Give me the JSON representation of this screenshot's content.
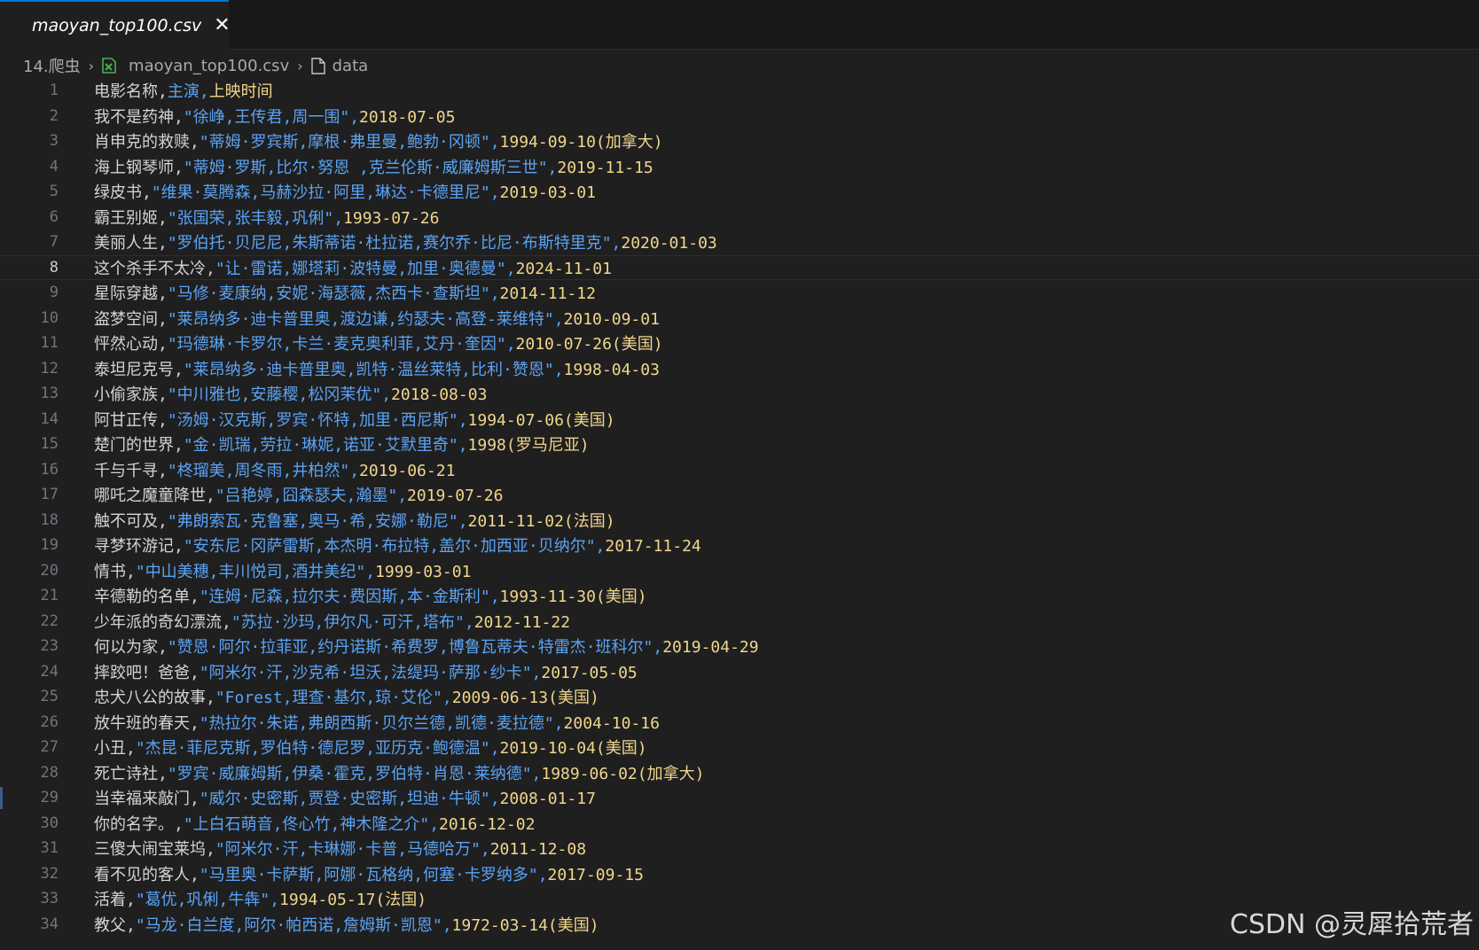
{
  "tab": {
    "title": "maoyan_top100.csv",
    "close_glyph": "✕"
  },
  "breadcrumb": {
    "folder": "14.爬虫",
    "file": "maoyan_top100.csv",
    "symbol": "data",
    "separator": "›"
  },
  "colors": {
    "field1": "#d4d4d4",
    "field2": "#5ba3f5",
    "field3": "#f1d68c",
    "accent": "#0078d4",
    "csv_icon": "#4caf50"
  },
  "active_line": 8,
  "lines": [
    {
      "n": "1",
      "a": "电影名称,",
      "b": "主演,",
      "c": "上映时间"
    },
    {
      "n": "2",
      "a": "我不是药神,",
      "b": "\"徐峥,王传君,周一围\",",
      "c": "2018-07-05"
    },
    {
      "n": "3",
      "a": "肖申克的救赎,",
      "b": "\"蒂姆·罗宾斯,摩根·弗里曼,鲍勃·冈顿\",",
      "c": "1994-09-10(加拿大)"
    },
    {
      "n": "4",
      "a": "海上钢琴师,",
      "b": "\"蒂姆·罗斯,比尔·努恩 ,克兰伦斯·威廉姆斯三世\",",
      "c": "2019-11-15"
    },
    {
      "n": "5",
      "a": "绿皮书,",
      "b": "\"维果·莫腾森,马赫沙拉·阿里,琳达·卡德里尼\",",
      "c": "2019-03-01"
    },
    {
      "n": "6",
      "a": "霸王别姬,",
      "b": "\"张国荣,张丰毅,巩俐\",",
      "c": "1993-07-26"
    },
    {
      "n": "7",
      "a": "美丽人生,",
      "b": "\"罗伯托·贝尼尼,朱斯蒂诺·杜拉诺,赛尔乔·比尼·布斯特里克\",",
      "c": "2020-01-03"
    },
    {
      "n": "8",
      "a": "这个杀手不太冷,",
      "b": "\"让·雷诺,娜塔莉·波特曼,加里·奥德曼\",",
      "c": "2024-11-01"
    },
    {
      "n": "9",
      "a": "星际穿越,",
      "b": "\"马修·麦康纳,安妮·海瑟薇,杰西卡·查斯坦\",",
      "c": "2014-11-12"
    },
    {
      "n": "10",
      "a": "盗梦空间,",
      "b": "\"莱昂纳多·迪卡普里奥,渡边谦,约瑟夫·高登-莱维特\",",
      "c": "2010-09-01"
    },
    {
      "n": "11",
      "a": "怦然心动,",
      "b": "\"玛德琳·卡罗尔,卡兰·麦克奥利菲,艾丹·奎因\",",
      "c": "2010-07-26(美国)"
    },
    {
      "n": "12",
      "a": "泰坦尼克号,",
      "b": "\"莱昂纳多·迪卡普里奥,凯特·温丝莱特,比利·赞恩\",",
      "c": "1998-04-03"
    },
    {
      "n": "13",
      "a": "小偷家族,",
      "b": "\"中川雅也,安藤樱,松冈茉优\",",
      "c": "2018-08-03"
    },
    {
      "n": "14",
      "a": "阿甘正传,",
      "b": "\"汤姆·汉克斯,罗宾·怀特,加里·西尼斯\",",
      "c": "1994-07-06(美国)"
    },
    {
      "n": "15",
      "a": "楚门的世界,",
      "b": "\"金·凯瑞,劳拉·琳妮,诺亚·艾默里奇\",",
      "c": "1998(罗马尼亚)"
    },
    {
      "n": "16",
      "a": "千与千寻,",
      "b": "\"柊瑠美,周冬雨,井柏然\",",
      "c": "2019-06-21"
    },
    {
      "n": "17",
      "a": "哪吒之魔童降世,",
      "b": "\"吕艳婷,囧森瑟夫,瀚墨\",",
      "c": "2019-07-26"
    },
    {
      "n": "18",
      "a": "触不可及,",
      "b": "\"弗朗索瓦·克鲁塞,奥马·希,安娜·勒尼\",",
      "c": "2011-11-02(法国)"
    },
    {
      "n": "19",
      "a": "寻梦环游记,",
      "b": "\"安东尼·冈萨雷斯,本杰明·布拉特,盖尔·加西亚·贝纳尔\",",
      "c": "2017-11-24"
    },
    {
      "n": "20",
      "a": "情书,",
      "b": "\"中山美穗,丰川悦司,酒井美纪\",",
      "c": "1999-03-01"
    },
    {
      "n": "21",
      "a": "辛德勒的名单,",
      "b": "\"连姆·尼森,拉尔夫·费因斯,本·金斯利\",",
      "c": "1993-11-30(美国)"
    },
    {
      "n": "22",
      "a": "少年派的奇幻漂流,",
      "b": "\"苏拉·沙玛,伊尔凡·可汗,塔布\",",
      "c": "2012-11-22"
    },
    {
      "n": "23",
      "a": "何以为家,",
      "b": "\"赞恩·阿尔·拉菲亚,约丹诺斯·希费罗,博鲁瓦蒂夫·特雷杰·班科尔\",",
      "c": "2019-04-29"
    },
    {
      "n": "24",
      "a": "摔跤吧！爸爸,",
      "b": "\"阿米尔·汗,沙克希·坦沃,法缇玛·萨那·纱卡\",",
      "c": "2017-05-05"
    },
    {
      "n": "25",
      "a": "忠犬八公的故事,",
      "b": "\"Forest,理查·基尔,琼·艾伦\",",
      "c": "2009-06-13(美国)"
    },
    {
      "n": "26",
      "a": "放牛班的春天,",
      "b": "\"热拉尔·朱诺,弗朗西斯·贝尔兰德,凯德·麦拉德\",",
      "c": "2004-10-16"
    },
    {
      "n": "27",
      "a": "小丑,",
      "b": "\"杰昆·菲尼克斯,罗伯特·德尼罗,亚历克·鲍德温\",",
      "c": "2019-10-04(美国)"
    },
    {
      "n": "28",
      "a": "死亡诗社,",
      "b": "\"罗宾·威廉姆斯,伊桑·霍克,罗伯特·肖恩·莱纳德\",",
      "c": "1989-06-02(加拿大)"
    },
    {
      "n": "29",
      "a": "当幸福来敲门,",
      "b": "\"威尔·史密斯,贾登·史密斯,坦迪·牛顿\",",
      "c": "2008-01-17"
    },
    {
      "n": "30",
      "a": "你的名字。,",
      "b": "\"上白石萌音,佟心竹,神木隆之介\",",
      "c": "2016-12-02"
    },
    {
      "n": "31",
      "a": "三傻大闹宝莱坞,",
      "b": "\"阿米尔·汗,卡琳娜·卡普,马德哈万\",",
      "c": "2011-12-08"
    },
    {
      "n": "32",
      "a": "看不见的客人,",
      "b": "\"马里奥·卡萨斯,阿娜·瓦格纳,何塞·卡罗纳多\",",
      "c": "2017-09-15"
    },
    {
      "n": "33",
      "a": "活着,",
      "b": "\"葛优,巩俐,牛犇\",",
      "c": "1994-05-17(法国)"
    },
    {
      "n": "34",
      "a": "教父,",
      "b": "\"马龙·白兰度,阿尔·帕西诺,詹姆斯·凯恩\",",
      "c": "1972-03-14(美国)"
    }
  ],
  "watermark": "CSDN @灵犀拾荒者"
}
